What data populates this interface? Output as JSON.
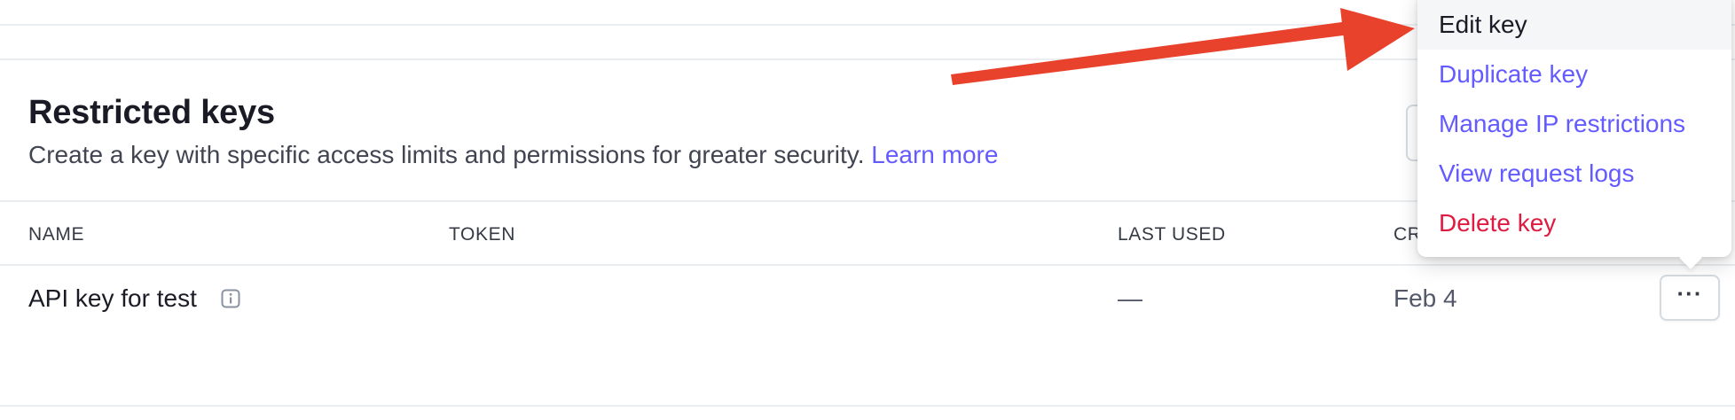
{
  "section": {
    "title": "Restricted keys",
    "description": "Create a key with specific access limits and permissions for greater security.",
    "learn_more": "Learn more"
  },
  "table": {
    "headers": [
      "NAME",
      "TOKEN",
      "LAST USED",
      "CR"
    ],
    "rows": [
      {
        "name": "API key for test",
        "token": "",
        "last_used": "—",
        "created": "Feb 4"
      }
    ]
  },
  "row_menu": {
    "trigger_label": "···",
    "items": [
      {
        "label": "Edit key"
      },
      {
        "label": "Duplicate key"
      },
      {
        "label": "Manage IP restrictions"
      },
      {
        "label": "View request logs"
      },
      {
        "label": "Delete key"
      }
    ]
  },
  "colors": {
    "accent": "#635bff",
    "danger": "#df1b41",
    "annotation_arrow": "#e8412c"
  }
}
